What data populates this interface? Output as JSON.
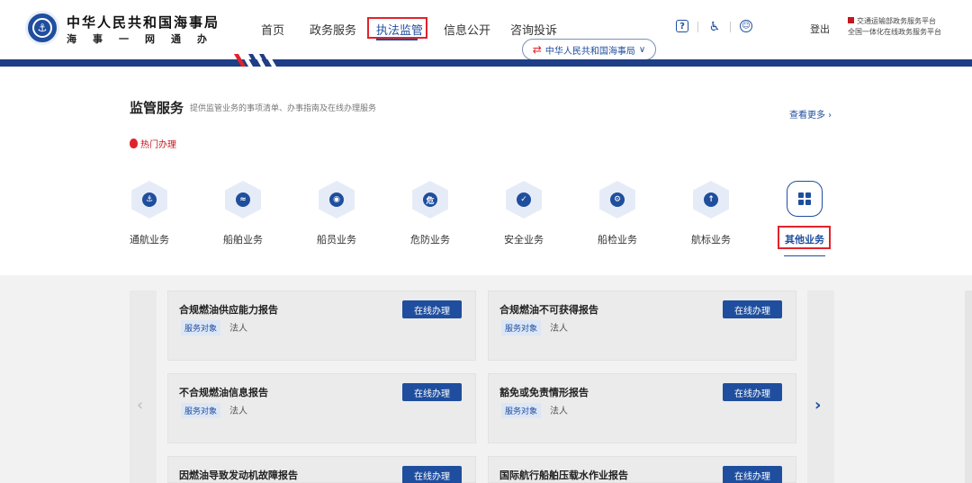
{
  "header": {
    "title": "中华人民共和国海事局",
    "subtitle": "海事一网通办",
    "nav": [
      "首页",
      "政务服务",
      "执法监管",
      "信息公开",
      "咨询投诉"
    ],
    "active_nav": "执法监管",
    "org_selector": "中华人民共和国海事局",
    "logout": "登出",
    "platform_line1": "交通运输部政务服务平台",
    "platform_line2": "全国一体化在线政务服务平台",
    "icons": [
      "help-icon",
      "accessibility-icon",
      "user-icon"
    ]
  },
  "section": {
    "title": "监管服务",
    "description": "提供监管业务的事项清单、办事指南及在线办理服务",
    "see_more": "查看更多 ›",
    "hot": "热门办理"
  },
  "categories": [
    {
      "label": "通航业务",
      "glyph": "⚓"
    },
    {
      "label": "船舶业务",
      "glyph": "≈"
    },
    {
      "label": "船员业务",
      "glyph": "◉"
    },
    {
      "label": "危防业务",
      "glyph": "危"
    },
    {
      "label": "安全业务",
      "glyph": "✓"
    },
    {
      "label": "船检业务",
      "glyph": "⚙"
    },
    {
      "label": "航标业务",
      "glyph": "↑"
    },
    {
      "label": "其他业务",
      "glyph": "▦"
    }
  ],
  "active_category": "其他业务",
  "cards": [
    {
      "title": "合规燃油供应能力报告",
      "tag": "服务对象",
      "target": "法人",
      "button": "在线办理"
    },
    {
      "title": "合规燃油不可获得报告",
      "tag": "服务对象",
      "target": "法人",
      "button": "在线办理"
    },
    {
      "title": "不合规燃油信息报告",
      "tag": "服务对象",
      "target": "法人",
      "button": "在线办理"
    },
    {
      "title": "豁免或免责情形报告",
      "tag": "服务对象",
      "target": "法人",
      "button": "在线办理"
    },
    {
      "title": "因燃油导致发动机故障报告",
      "tag": "",
      "target": "",
      "button": "在线办理"
    },
    {
      "title": "国际航行船舶压载水作业报告",
      "tag": "",
      "target": "",
      "button": "在线办理"
    }
  ],
  "colors": {
    "brand_blue": "#1f4e9e",
    "band_blue": "#1f3e85",
    "highlight_red": "#e0232b"
  }
}
